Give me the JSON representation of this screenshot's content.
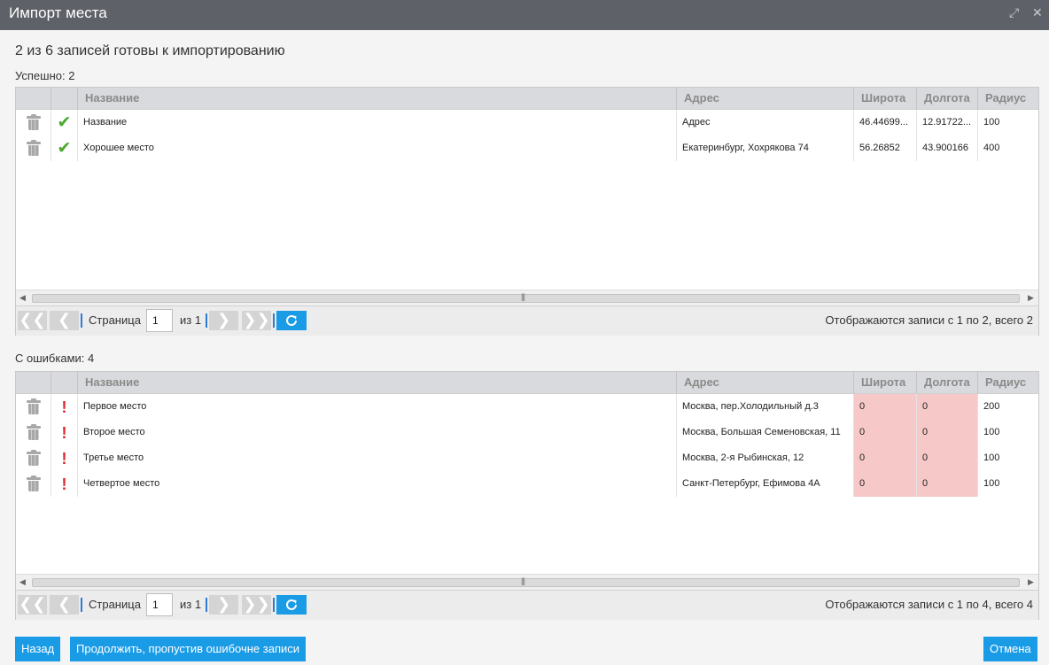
{
  "window": {
    "title": "Импорт места"
  },
  "heading": "2 из 6 записей готовы к импортированию",
  "columns": {
    "name": "Название",
    "address": "Адрес",
    "lat": "Широта",
    "lon": "Долгота",
    "radius": "Радиус"
  },
  "success": {
    "label": "Успешно: 2",
    "rows": [
      {
        "name": "Название",
        "address": "Адрес",
        "lat": "46.44699...",
        "lon": "12.91722...",
        "radius": "100"
      },
      {
        "name": "Хорошее место",
        "address": "Екатеринбург, Хохрякова 74",
        "lat": "56.26852",
        "lon": "43.900166",
        "radius": "400"
      }
    ],
    "pager": {
      "page_label": "Страница",
      "page_value": "1",
      "of_label": "из 1",
      "info": "Отображаются записи с 1 по 2, всего 2"
    }
  },
  "errors": {
    "label": "С ошибками: 4",
    "rows": [
      {
        "name": "Первое место",
        "address": "Москва, пер.Холодильный д.3",
        "lat": "0",
        "lon": "0",
        "radius": "200"
      },
      {
        "name": "Второе место",
        "address": "Москва, Большая Семеновская, 11",
        "lat": "0",
        "lon": "0",
        "radius": "100"
      },
      {
        "name": "Третье место",
        "address": "Москва, 2-я Рыбинская, 12",
        "lat": "0",
        "lon": "0",
        "radius": "100"
      },
      {
        "name": "Четвертое место",
        "address": "Санкт-Петербург, Ефимова 4А",
        "lat": "0",
        "lon": "0",
        "radius": "100"
      }
    ],
    "pager": {
      "page_label": "Страница",
      "page_value": "1",
      "of_label": "из 1",
      "info": "Отображаются записи с 1 по 4, всего 4"
    }
  },
  "buttons": {
    "back": "Назад",
    "continue": "Продолжить, пропустив ошибочне записи",
    "cancel": "Отмена"
  },
  "colors": {
    "titlebar": "#5f6168",
    "accent": "#1a9be6",
    "error_cell": "#f6c8c8",
    "check": "#4ca82f",
    "error_mark": "#e0252d"
  },
  "icons": {
    "success_status": "check-icon",
    "error_status": "exclamation-icon",
    "delete": "trash-icon"
  }
}
